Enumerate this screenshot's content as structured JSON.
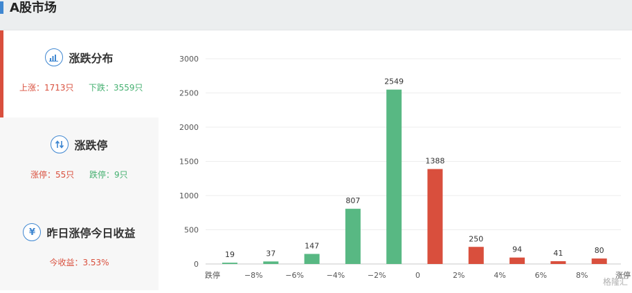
{
  "header": {
    "title": "A股市场"
  },
  "panels": {
    "distribution": {
      "title": "涨跌分布",
      "icon": "bar-chart-icon",
      "up": "上涨：1713只",
      "down": "下跌：3559只"
    },
    "limit": {
      "title": "涨跌停",
      "icon": "up-down-arrows-icon",
      "up": "涨停：55只",
      "down": "跌停：9只"
    },
    "yesterday": {
      "title": "昨日涨停今日收益",
      "icon": "yen-icon",
      "value": "今收益：3.53%"
    }
  },
  "watermark": "格隆汇",
  "colors": {
    "up": "#d94f3d",
    "down": "#58b883",
    "accent": "#3f87d1"
  },
  "chart_data": {
    "type": "bar",
    "categories": [
      "跌停",
      "−8%",
      "−6%",
      "−4%",
      "−2%",
      "0",
      "2%",
      "4%",
      "6%",
      "8%",
      "涨停"
    ],
    "bars": [
      {
        "value": 19,
        "color": "down"
      },
      {
        "value": 37,
        "color": "down"
      },
      {
        "value": 147,
        "color": "down"
      },
      {
        "value": 807,
        "color": "down"
      },
      {
        "value": 2549,
        "color": "down"
      },
      {
        "value": 1388,
        "color": "up"
      },
      {
        "value": 250,
        "color": "up"
      },
      {
        "value": 94,
        "color": "up"
      },
      {
        "value": 41,
        "color": "up"
      },
      {
        "value": 80,
        "color": "up"
      }
    ],
    "ylim": [
      0,
      3000
    ],
    "yticks": [
      0,
      500,
      1000,
      1500,
      2000,
      2500,
      3000
    ],
    "grid": true
  }
}
